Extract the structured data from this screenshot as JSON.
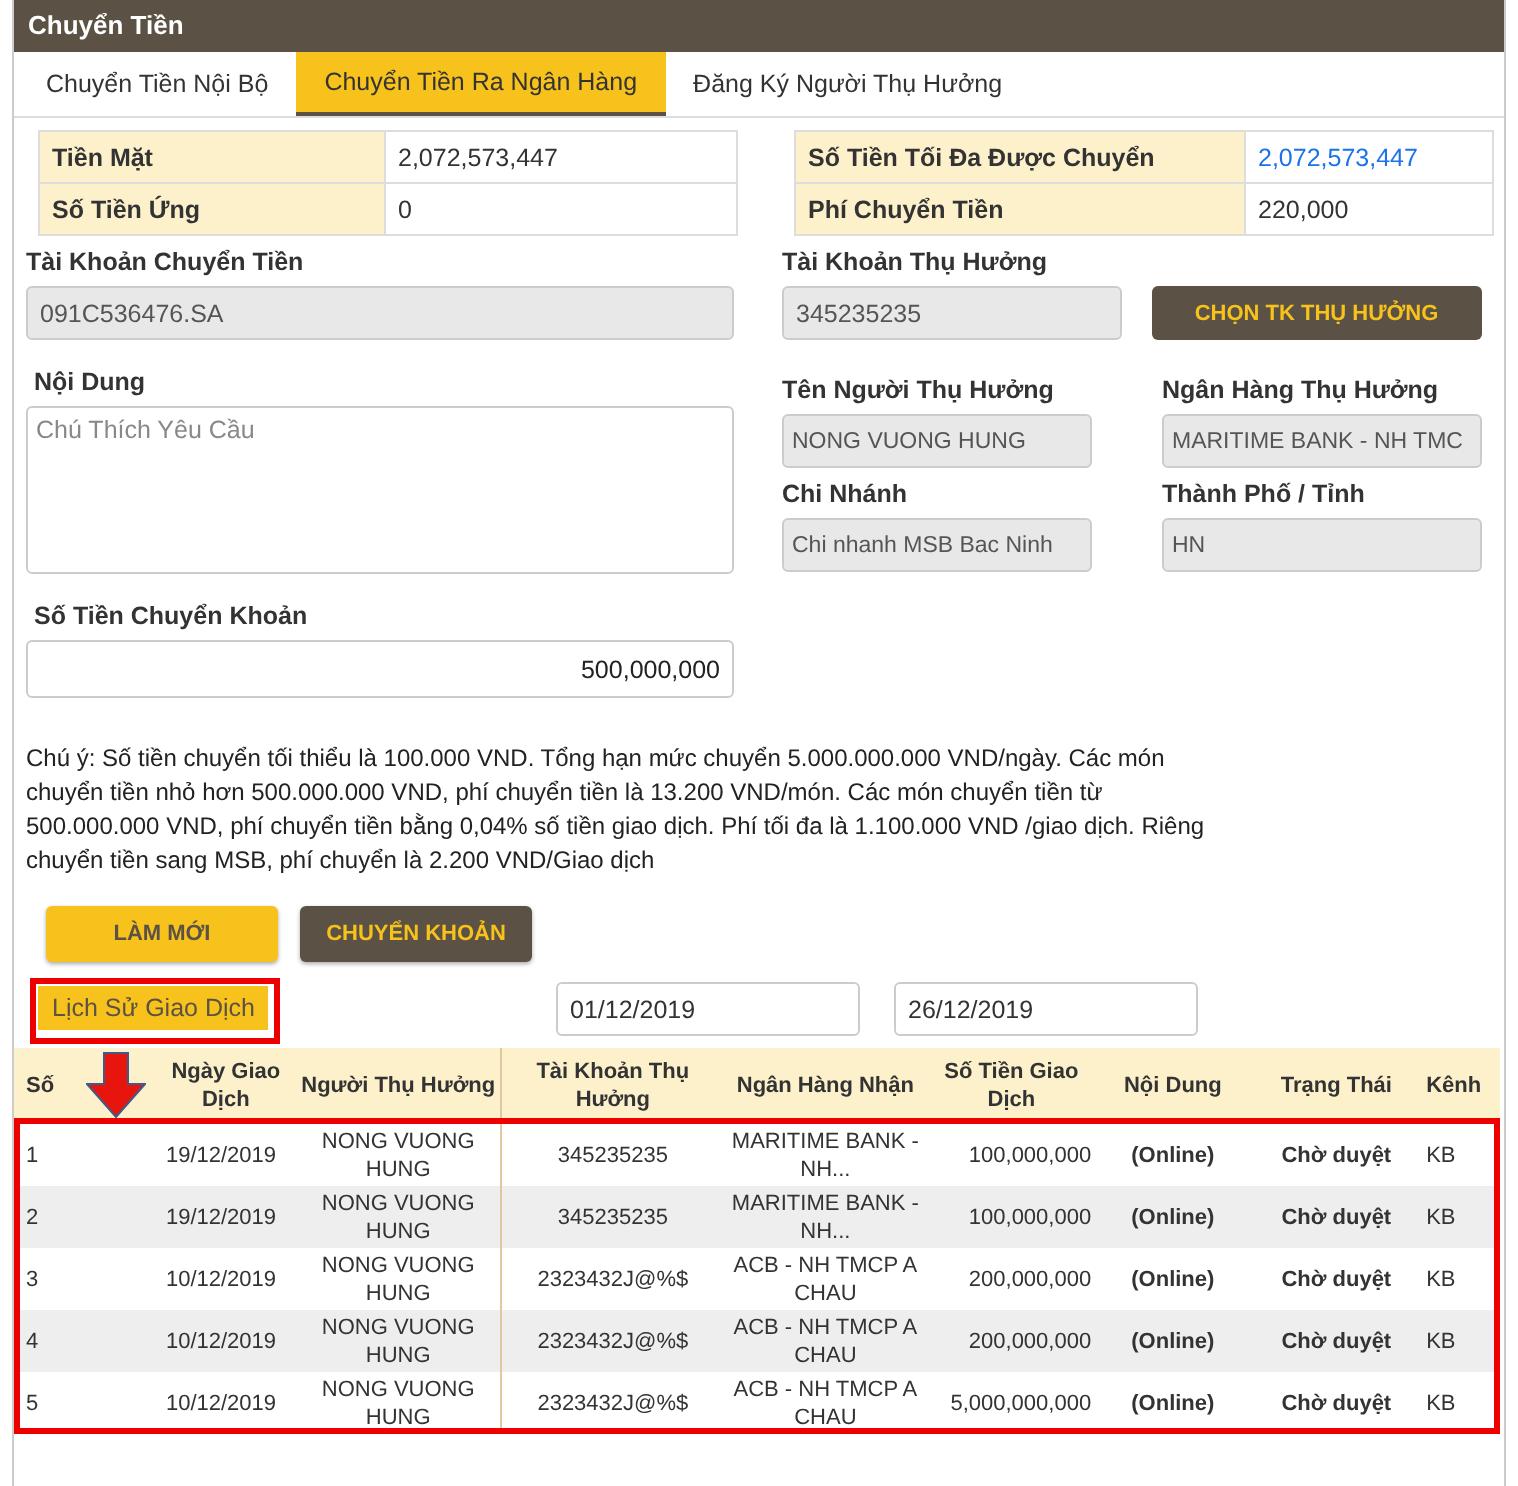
{
  "window": {
    "title": "Chuyển Tiền"
  },
  "tabs": [
    {
      "label": "Chuyển Tiền Nội Bộ",
      "selected": false
    },
    {
      "label": "Chuyển Tiền Ra Ngân Hàng",
      "selected": true
    },
    {
      "label": "Đăng Ký Người Thụ Hưởng",
      "selected": false
    }
  ],
  "balances_left": [
    {
      "label": "Tiền Mặt",
      "value": "2,072,573,447",
      "highlight": false
    },
    {
      "label": "Số Tiền Ứng",
      "value": "0",
      "highlight": false
    }
  ],
  "balances_right": [
    {
      "label": "Số Tiền Tối Đa Được Chuyển",
      "value": "2,072,573,447",
      "highlight": true
    },
    {
      "label": "Phí Chuyển Tiền",
      "value": "220,000",
      "highlight": false
    }
  ],
  "source_account": {
    "label": "Tài Khoản Chuyển Tiền",
    "value": "091C536476.SA"
  },
  "beneficiary_account": {
    "label": "Tài Khoản Thụ Hưởng",
    "value": "345235235",
    "button": "CHỌN TK THỤ HƯỞNG"
  },
  "content": {
    "label": "Nội Dung",
    "placeholder": "Chú Thích Yêu Cầu"
  },
  "amount": {
    "label": "Số Tiền Chuyển Khoản",
    "value": "500,000,000"
  },
  "beneficiary_fields": [
    {
      "label": "Tên Người Thụ Hưởng",
      "value": "NONG VUONG HUNG"
    },
    {
      "label": "Ngân Hàng Thụ Hưởng",
      "value": "MARITIME BANK - NH TMC"
    },
    {
      "label": "Chi Nhánh",
      "value": "Chi nhanh MSB Bac Ninh"
    },
    {
      "label": "Thành Phố / Tỉnh",
      "value": "HN"
    }
  ],
  "note": "Chú ý: Số tiền chuyển tối thiểu là 100.000 VND. Tổng hạn mức chuyển 5.000.000.000 VND/ngày. Các món chuyển tiền nhỏ hơn 500.000.000 VND, phí chuyển tiền là 13.200 VND/món. Các món chuyển tiền từ 500.000.000 VND, phí chuyển tiền bằng 0,04% số tiền giao dịch. Phí tối đa là 1.100.000 VND /giao dịch. Riêng chuyển tiền sang MSB, phí chuyển là 2.200 VND/Giao dịch",
  "buttons": [
    {
      "label": "LÀM MỚI",
      "kind": "secondary"
    },
    {
      "label": "CHUYỂN KHOẢN",
      "kind": "primary"
    }
  ],
  "history": {
    "button": "Lịch Sử Giao Dịch",
    "from_date": "01/12/2019",
    "to_date": "26/12/2019",
    "columns": [
      "Số",
      "Ngày Giao Dịch",
      "Người Thụ Hưởng",
      "Tài Khoản Thụ Hưởng",
      "Ngân Hàng Nhận",
      "Số Tiền Giao Dịch",
      "Nội Dung",
      "Trạng Thái",
      "Kênh"
    ],
    "rows": [
      [
        "1",
        "19/12/2019",
        "NONG VUONG HUNG",
        "345235235",
        "MARITIME BANK - NH...",
        "100,000,000",
        "(Online)",
        "Chờ duyệt",
        "KB"
      ],
      [
        "2",
        "19/12/2019",
        "NONG VUONG HUNG",
        "345235235",
        "MARITIME BANK - NH...",
        "100,000,000",
        "(Online)",
        "Chờ duyệt",
        "KB"
      ],
      [
        "3",
        "10/12/2019",
        "NONG VUONG HUNG",
        "2323432J@%$",
        "ACB - NH TMCP A CHAU",
        "200,000,000",
        "(Online)",
        "Chờ duyệt",
        "KB"
      ],
      [
        "4",
        "10/12/2019",
        "NONG VUONG HUNG",
        "2323432J@%$",
        "ACB - NH TMCP A CHAU",
        "200,000,000",
        "(Online)",
        "Chờ duyệt",
        "KB"
      ],
      [
        "5",
        "10/12/2019",
        "NONG VUONG HUNG",
        "2323432J@%$",
        "ACB - NH TMCP A CHAU",
        "5,000,000,000",
        "(Online)",
        "Chờ duyệt",
        "KB"
      ]
    ]
  }
}
